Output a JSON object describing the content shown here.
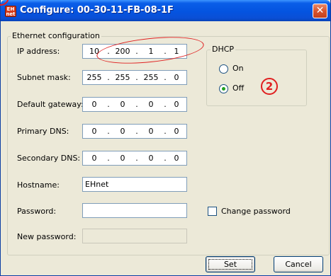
{
  "window": {
    "title": "Configure: 00-30-11-FB-08-1F",
    "icon_label": "EH net",
    "close_label": "✕"
  },
  "group": {
    "title": "Ethernet configuration",
    "ip_label": "IP address:",
    "ip": [
      "10",
      "200",
      "1",
      "1"
    ],
    "subnet_label": "Subnet mask:",
    "subnet": [
      "255",
      "255",
      "255",
      "0"
    ],
    "gateway_label": "Default gateway:",
    "gateway": [
      "0",
      "0",
      "0",
      "0"
    ],
    "dns1_label": "Primary DNS:",
    "dns1": [
      "0",
      "0",
      "0",
      "0"
    ],
    "dns2_label": "Secondary DNS:",
    "dns2": [
      "0",
      "0",
      "0",
      "0"
    ],
    "hostname_label": "Hostname:",
    "hostname": "EHnet",
    "password_label": "Password:",
    "password": "",
    "newpassword_label": "New password:",
    "newpassword": "",
    "change_password_label": "Change password",
    "change_password_checked": false
  },
  "dhcp": {
    "title": "DHCP",
    "on_label": "On",
    "off_label": "Off",
    "selected": "Off"
  },
  "buttons": {
    "set": "Set",
    "cancel": "Cancel"
  },
  "annotations": {
    "marker2": "2"
  },
  "colors": {
    "titlebar": "#0454e0",
    "annotation": "#e02020",
    "dialog_bg": "#ece9d8"
  }
}
